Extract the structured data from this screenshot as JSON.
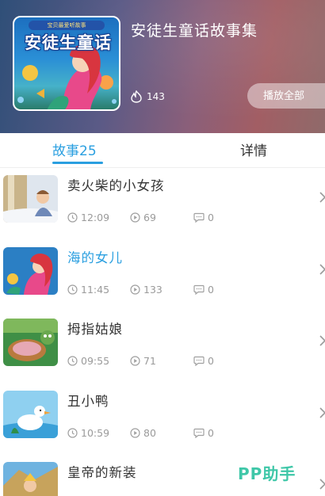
{
  "album": {
    "cover_subtitle": "宝贝最爱听故事",
    "cover_title": "安徒生童话",
    "title": "安徒生童话故事集",
    "play_count": "143",
    "play_all_label": "播放全部"
  },
  "tabs": [
    {
      "label": "故事25",
      "active": true
    },
    {
      "label": "详情",
      "active": false
    }
  ],
  "stories": [
    {
      "title": "卖火柴的小女孩",
      "duration": "12:09",
      "plays": "69",
      "comments": "0",
      "active": false
    },
    {
      "title": "海的女儿",
      "duration": "11:45",
      "plays": "133",
      "comments": "0",
      "active": true
    },
    {
      "title": "拇指姑娘",
      "duration": "09:55",
      "plays": "71",
      "comments": "0",
      "active": false
    },
    {
      "title": "丑小鸭",
      "duration": "10:59",
      "plays": "80",
      "comments": "0",
      "active": false
    },
    {
      "title": "皇帝的新装",
      "duration": "",
      "plays": "",
      "comments": "",
      "active": false
    }
  ],
  "watermark": "PP助手",
  "colors": {
    "accent": "#2a9fe0",
    "watermark": "#3fc7a8"
  },
  "icons": [
    "fire-icon",
    "clock-icon",
    "play-circle-icon",
    "comment-icon",
    "chevron-right-icon"
  ]
}
